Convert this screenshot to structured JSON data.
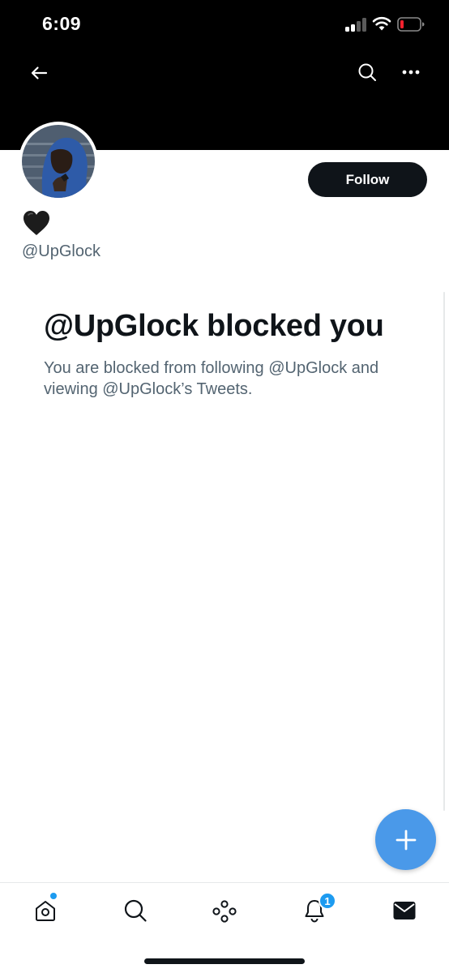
{
  "status_bar": {
    "time": "6:09",
    "icons": [
      "signal-icon",
      "wifi-icon",
      "battery-low-icon"
    ]
  },
  "header": {
    "back_icon": "arrow-left-icon",
    "search_icon": "search-icon",
    "more_icon": "more-horizontal-icon"
  },
  "profile": {
    "display_name": "🖤",
    "handle": "@UpGlock",
    "follow_label": "Follow"
  },
  "blocked": {
    "title": "@UpGlock blocked you",
    "body": "You are blocked from following @UpGlock and viewing @UpGlock’s Tweets."
  },
  "fab": {
    "icon": "plus-icon"
  },
  "tab_bar": {
    "items": [
      {
        "name": "home",
        "icon": "home-icon"
      },
      {
        "name": "search",
        "icon": "search-icon"
      },
      {
        "name": "spaces",
        "icon": "spaces-icon"
      },
      {
        "name": "notifications",
        "icon": "bell-icon",
        "badge": "1"
      },
      {
        "name": "messages",
        "icon": "mail-icon"
      }
    ]
  },
  "colors": {
    "banner": "#000000",
    "follow_button": "#0f1419",
    "accent": "#1d9bf0",
    "fab": "#4a99e9",
    "battery_low": "#f4212e",
    "secondary_text": "#536471"
  }
}
